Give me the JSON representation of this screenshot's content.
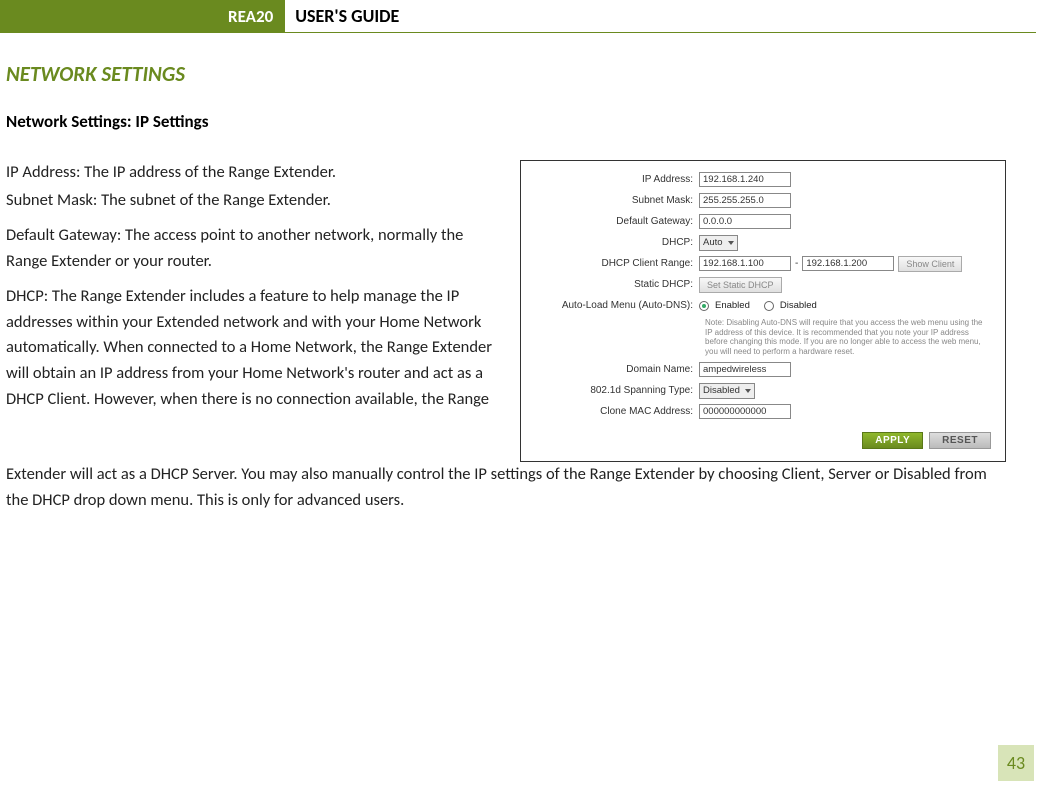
{
  "header": {
    "badge": "REA20",
    "title": "USER'S GUIDE"
  },
  "section_title": "NETWORK SETTINGS",
  "subsection_title": "Network Settings: IP Settings",
  "body": {
    "p1": "IP Address: The IP address of the Range Extender.",
    "p2": "Subnet Mask: The subnet of the Range Extender.",
    "p3": "Default Gateway: The access point to another network, normally the Range Extender or your router.",
    "p4": "DHCP: The Range Extender includes a feature to help manage the IP addresses within your Extended network and with your Home Network automatically. When connected to a Home Network, the Range Extender will obtain an IP address from your Home Network's router and act as a DHCP Client. However, when there is no connection available, the Range",
    "p5": "Extender will act as a DHCP Server. You may also manually control the IP settings of the Range Extender by choosing Client, Server or Disabled from the DHCP drop down menu. This is only for advanced users."
  },
  "panel": {
    "labels": {
      "ip_address": "IP Address:",
      "subnet_mask": "Subnet Mask:",
      "default_gateway": "Default Gateway:",
      "dhcp": "DHCP:",
      "dhcp_client_range": "DHCP Client Range:",
      "static_dhcp": "Static DHCP:",
      "auto_load": "Auto-Load Menu (Auto-DNS):",
      "domain_name": "Domain Name:",
      "spanning_type": "802.1d Spanning Type:",
      "clone_mac": "Clone MAC Address:"
    },
    "values": {
      "ip_address": "192.168.1.240",
      "subnet_mask": "255.255.255.0",
      "default_gateway": "0.0.0.0",
      "dhcp": "Auto",
      "dhcp_range_start": "192.168.1.100",
      "dhcp_range_end": "192.168.1.200",
      "domain_name": "ampedwireless",
      "spanning_type": "Disabled",
      "clone_mac": "000000000000"
    },
    "buttons": {
      "show_client": "Show Client",
      "set_static_dhcp": "Set Static DHCP",
      "apply": "APPLY",
      "reset": "RESET"
    },
    "radio": {
      "enabled": "Enabled",
      "disabled": "Disabled"
    },
    "note": "Note: Disabling Auto-DNS will require that you access the web menu using the IP address of this device. It is recommended that you note your IP address before changing this mode. If you are no longer able to access the web menu, you will need to perform a hardware reset.",
    "dash": "-"
  },
  "page_number": "43"
}
